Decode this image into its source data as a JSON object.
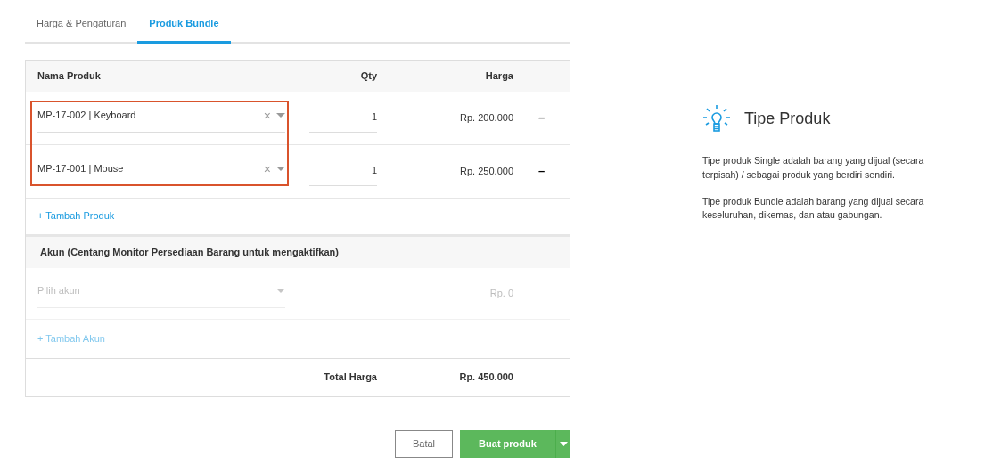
{
  "tabs": [
    {
      "label": "Harga & Pengaturan",
      "selected": false
    },
    {
      "label": "Produk Bundle",
      "selected": true
    }
  ],
  "products": {
    "columns": [
      "Nama Produk",
      "Qty",
      "Harga"
    ],
    "rows": [
      {
        "product": "MP-17-002 | Keyboard",
        "clear": "×",
        "qty": "1",
        "price": "Rp. 200.000",
        "remove": "–"
      },
      {
        "product": "MP-17-001 | Mouse",
        "clear": "×",
        "qty": "1",
        "price": "Rp. 250.000",
        "remove": "–"
      }
    ],
    "highlighted": true,
    "add_link": "+ Tambah Produk"
  },
  "accounts": {
    "heading": "Akun (Centang Monitor Persediaan Barang untuk mengaktifkan)",
    "disabled": true,
    "rows": [
      {
        "placeholder": "Pilih akun",
        "amount": "Rp. 0"
      }
    ],
    "add_link": "+ Tambah Akun"
  },
  "total": {
    "label": "Total Harga",
    "value": "Rp. 450.000"
  },
  "buttons": {
    "cancel": "Batal",
    "submit": "Buat produk"
  },
  "info": {
    "title": "Tipe Produk",
    "paragraphs": [
      "Tipe produk Single adalah barang yang dijual (secara terpisah) / sebagai produk yang berdiri sendiri.",
      "Tipe produk Bundle adalah barang yang dijual secara keseluruhan, dikemas, dan atau gabungan."
    ]
  }
}
